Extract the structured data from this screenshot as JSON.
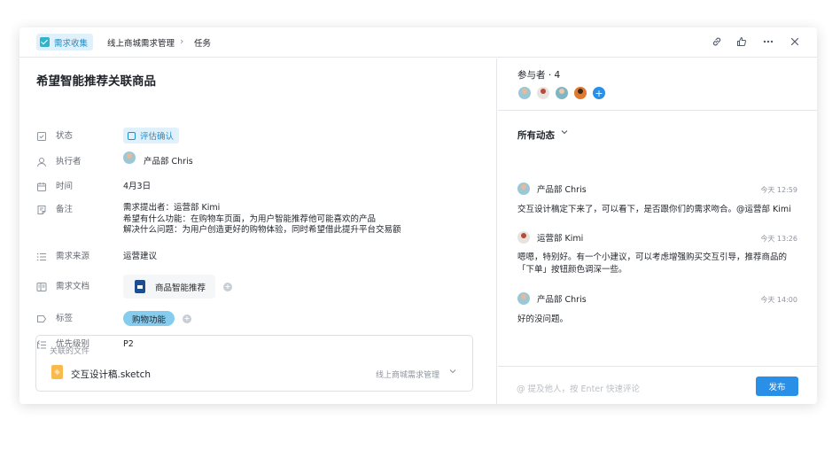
{
  "header": {
    "app_tag": "需求收集",
    "breadcrumb_project": "线上商城需求管理",
    "breadcrumb_page": "任务"
  },
  "task": {
    "title": "希望智能推荐关联商品",
    "fields": {
      "status": {
        "label": "状态",
        "value": "评估确认"
      },
      "assignee": {
        "label": "执行者",
        "value": "产品部 Chris"
      },
      "time": {
        "label": "时间",
        "value": "4月3日"
      },
      "note": {
        "label": "备注",
        "lines": [
          "需求提出者：运营部 Kimi",
          "希望有什么功能：在购物车页面，为用户智能推荐他可能喜欢的产品",
          "解决什么问题：为用户创造更好的购物体验，同时希望借此提升平台交易额"
        ]
      },
      "source": {
        "label": "需求来源",
        "value": "运营建议"
      },
      "doc": {
        "label": "需求文档",
        "value": "商品智能推荐"
      },
      "tags": {
        "label": "标签",
        "value": "购物功能"
      },
      "priority": {
        "label": "优先级别",
        "value": "P2"
      }
    },
    "linked_files": {
      "header": "关联的文件",
      "items": [
        {
          "name": "交互设计稿.sketch",
          "project": "线上商城需求管理"
        }
      ]
    }
  },
  "participants": {
    "title": "参与者 · 4",
    "count": 4
  },
  "activity": {
    "title": "所有动态",
    "items": [
      {
        "author": "产品部 Chris",
        "time": "今天 12:59",
        "message": "交互设计稿定下来了，可以看下，是否跟你们的需求吻合。@运营部 Kimi"
      },
      {
        "author": "运营部 Kimi",
        "time": "今天 13:26",
        "message": "嗯嗯，特别好。有一个小建议，可以考虑增强购买交互引导，推荐商品的「下单」按钮颜色调深一些。"
      },
      {
        "author": "产品部 Chris",
        "time": "今天 14:00",
        "message": "好的没问题。"
      }
    ]
  },
  "comment": {
    "placeholder": "@ 提及他人，按 Enter 快速评论",
    "send_label": "发布"
  },
  "colors": {
    "accent": "#2a8fe6",
    "tag_bg": "#e1f1fb",
    "label_chip": "#86ccef"
  }
}
